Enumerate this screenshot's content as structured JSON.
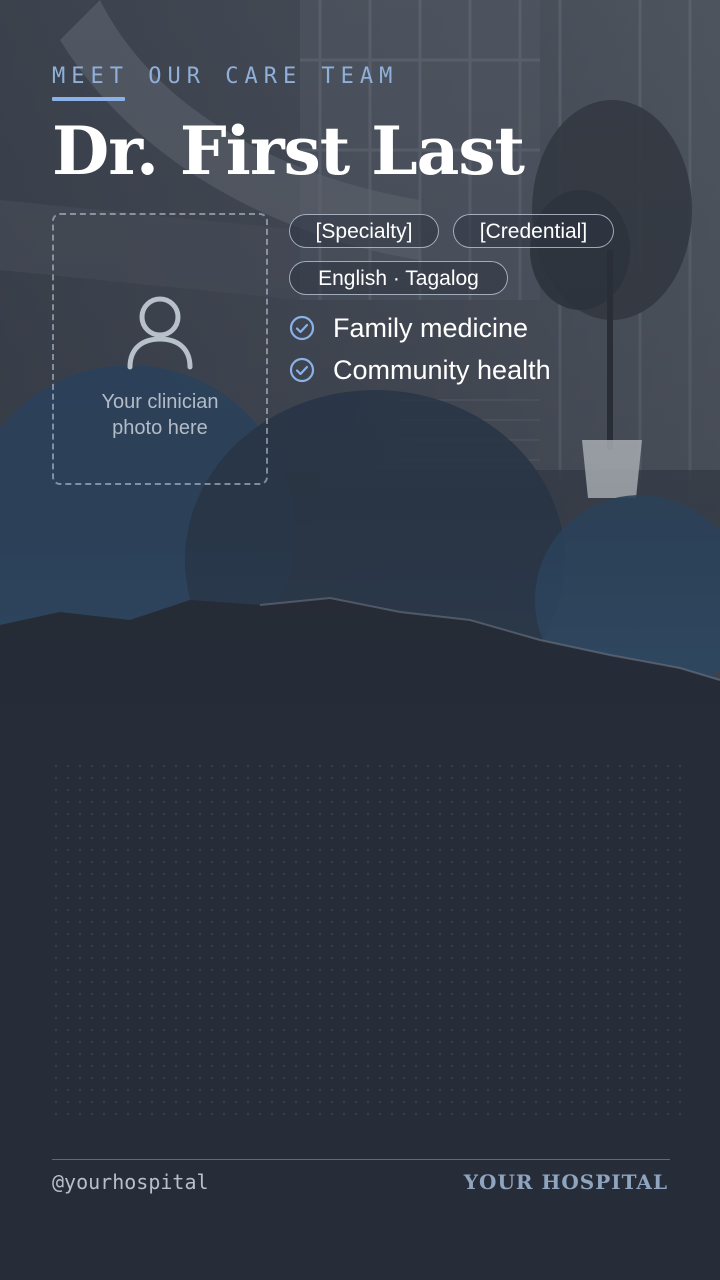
{
  "eyebrow": "MEET OUR CARE TEAM",
  "doctor_name": "Dr. First Last",
  "photo_placeholder": {
    "icon": "person-icon",
    "line1": "Your clinician",
    "line2": "photo here"
  },
  "tags": [
    "[Specialty]",
    "[Credential]",
    "English · Tagalog"
  ],
  "focus_areas": [
    "Family medicine",
    "Community health"
  ],
  "footer": {
    "handle": "@yourhospital",
    "hospital": "YOUR HOSPITAL"
  },
  "colors": {
    "background": "#272d38",
    "accent": "#8bb2e8",
    "blob": "#2f4a66"
  }
}
